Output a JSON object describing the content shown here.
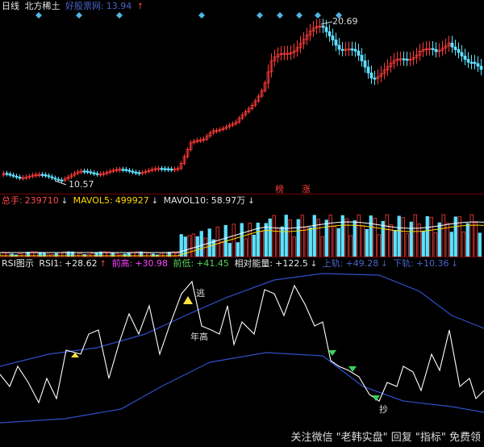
{
  "price_header": {
    "period": "日线",
    "name": "北方稀土",
    "site": "好股票网:",
    "price": "13.94",
    "arrow": "↑"
  },
  "price_labels": {
    "high": "20.69",
    "low": "10.57",
    "mark1": "榜",
    "mark2": "涨"
  },
  "vol_header": {
    "total_label": "总手:",
    "total_value": "239710",
    "total_arrow": "↓",
    "mavol5_label": "MAVOL5:",
    "mavol5_value": "499927",
    "mavol5_arrow": "↓",
    "mavol10_label": "MAVOL10:",
    "mavol10_value": "58.97万",
    "mavol10_arrow": "↓"
  },
  "rsi_header": {
    "title": "RSI图示",
    "rsi1_label": "RSI1:",
    "rsi1_value": "+28.62",
    "rsi1_arrow": "↑",
    "prevhigh_label": "前高:",
    "prevhigh_value": "+30.98",
    "prevlow_label": "前低:",
    "prevlow_value": "+41.45",
    "energy_label": "相对能量:",
    "energy_value": "+122.5",
    "energy_arrow": "↓",
    "upper_label": "上轨:",
    "upper_value": "+49.28",
    "upper_arrow": "↓",
    "lower_label": "下轨:",
    "lower_value": "+10.36",
    "lower_arrow": "↓"
  },
  "rsi_marks": {
    "escape": "逃",
    "yearhigh": "年高",
    "buy": "抄"
  },
  "watermark": "关注微信 \"老韩实盘\" 回复 \"指标\" 免费领",
  "colors": {
    "up": "#ff3b3b",
    "down": "#5fe0ff",
    "bg": "#000000",
    "rsi_line": "#ffffff",
    "band": "#2f4fc8"
  }
}
